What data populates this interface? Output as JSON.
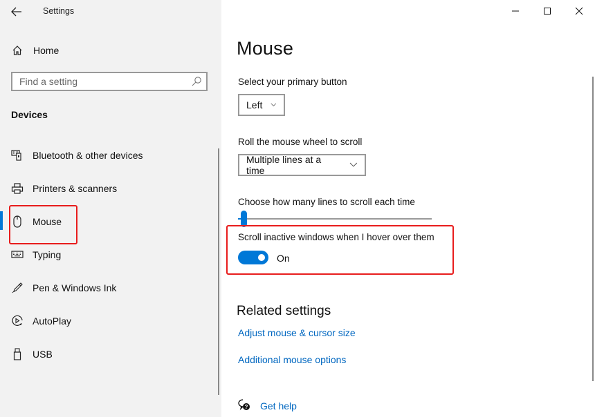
{
  "window": {
    "title": "Settings",
    "controls": {
      "minimize": "minimize-icon",
      "maximize": "maximize-icon",
      "close": "close-icon"
    }
  },
  "sidebar": {
    "home_label": "Home",
    "search_placeholder": "Find a setting",
    "section_title": "Devices",
    "items": [
      {
        "label": "Bluetooth & other devices",
        "icon": "bluetooth-devices-icon"
      },
      {
        "label": "Printers & scanners",
        "icon": "printer-icon"
      },
      {
        "label": "Mouse",
        "icon": "mouse-icon",
        "selected": true
      },
      {
        "label": "Typing",
        "icon": "keyboard-icon"
      },
      {
        "label": "Pen & Windows Ink",
        "icon": "pen-icon"
      },
      {
        "label": "AutoPlay",
        "icon": "autoplay-icon"
      },
      {
        "label": "USB",
        "icon": "usb-icon"
      }
    ]
  },
  "main": {
    "title": "Mouse",
    "primary_button": {
      "label": "Select your primary button",
      "value": "Left"
    },
    "wheel_scroll": {
      "label": "Roll the mouse wheel to scroll",
      "value": "Multiple lines at a time"
    },
    "lines_slider": {
      "label": "Choose how many lines to scroll each time",
      "value_fraction": 0.03
    },
    "inactive_scroll": {
      "label": "Scroll inactive windows when I hover over them",
      "state": "On",
      "on": true
    },
    "related": {
      "title": "Related settings",
      "links": [
        "Adjust mouse & cursor size",
        "Additional mouse options"
      ]
    },
    "help": {
      "label": "Get help",
      "icon": "get-help-icon"
    }
  },
  "colors": {
    "accent": "#0078d7",
    "link": "#0067c0",
    "highlight": "#e81c1c",
    "sidebar_bg": "#f2f2f2"
  }
}
